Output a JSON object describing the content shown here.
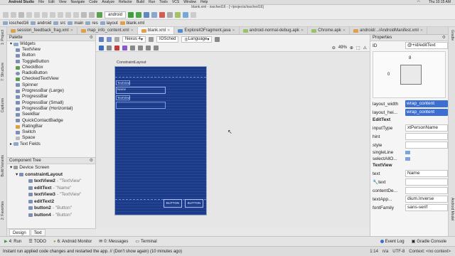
{
  "mac_menu": {
    "app": "Android Studio",
    "items": [
      "File",
      "Edit",
      "View",
      "Navigate",
      "Code",
      "Analyze",
      "Refactor",
      "Build",
      "Run",
      "Tools",
      "VCS",
      "Window",
      "Help"
    ],
    "clock": "Thu 10:15 AM"
  },
  "window_title": "blank.xml - iosched16 - [~/projects/iosched16]",
  "toolbar": {
    "run_config": "android"
  },
  "breadcrumbs": [
    "iosched16",
    "android",
    "src",
    "main",
    "res",
    "layout",
    "blank.xml"
  ],
  "tabs": [
    "session_feedback_frag.xml",
    "map_info_content.xml",
    "blank.xml",
    "ExploreIOFragment.java",
    "android-normal-debug.apk",
    "Chrome.apk",
    "android/.../AndroidManifest.xml"
  ],
  "active_tab": "blank.xml",
  "palette": {
    "title": "Palette",
    "group": "Widgets",
    "items": [
      "TextView",
      "Button",
      "ToggleButton",
      "CheckBox",
      "RadioButton",
      "CheckedTextView",
      "Spinner",
      "ProgressBar (Large)",
      "ProgressBar",
      "ProgressBar (Small)",
      "ProgressBar (Horizontal)",
      "SeekBar",
      "QuickContactBadge",
      "RatingBar",
      "Switch",
      "Space"
    ],
    "next_group": "Text Fields"
  },
  "component_tree": {
    "title": "Component Tree",
    "root": "Device Screen",
    "layout": "constraintLayout",
    "children": [
      {
        "id": "textView2",
        "desc": "- \"TextView\""
      },
      {
        "id": "editText",
        "desc": "- \"Name\""
      },
      {
        "id": "textView3",
        "desc": "- \"TextView\""
      },
      {
        "id": "editText2",
        "desc": ""
      },
      {
        "id": "button2",
        "desc": "- \"Button\""
      },
      {
        "id": "button4",
        "desc": "- \"Button\""
      }
    ]
  },
  "editor": {
    "device": "Nexus 4",
    "theme": "IOSched",
    "language": "Language",
    "zoom": "49%",
    "canvas_label": "ConstraintLayout",
    "widgets": {
      "tv1": "TextView",
      "et1": "Name",
      "tv2": "TextView",
      "btn1": "BUTTON",
      "btn2": "BUTTON"
    }
  },
  "mode_tabs": [
    "Design",
    "Text"
  ],
  "properties": {
    "title": "Properties",
    "id_label": "ID",
    "id_value": "@+id/editText",
    "constraint_top": "8",
    "constraint_left": "0",
    "layout_width_label": "layout_width",
    "layout_width_value": "wrap_content",
    "layout_height_label": "layout_hei...",
    "layout_height_value": "wrap_content",
    "section_edittext": "EditText",
    "input_type_label": "inputType",
    "input_type_value": "xtPersonName",
    "hint_label": "hint",
    "style_label": "style",
    "single_line_label": "singleLine",
    "select_all_label": "selectAllO...",
    "section_textview": "TextView",
    "text_label": "text",
    "text_value": "Name",
    "text2_label": "text",
    "content_desc_label": "contentDe...",
    "text_appearance_label": "textApp...",
    "text_appearance_value": "dium.Inverse",
    "font_family_label": "fontFamily",
    "font_family_value": "sans-serif"
  },
  "bottom_tools": [
    "4: Run",
    "TODO",
    "6: Android Monitor",
    "0: Messages",
    "Terminal"
  ],
  "bottom_right": [
    "Event Log",
    "Gradle Console"
  ],
  "status_message": "Instant run applied code changes and restarted the app. // (Don't show again) (10 minutes ago)",
  "status_right": [
    "1:14",
    "n/a",
    "UTF-8",
    "Context: <no context>"
  ],
  "side_tabs_left": [
    "1: Project",
    "7: Structure",
    "Captures",
    "Build Variants",
    "2: Favorites"
  ],
  "side_tabs_right": [
    "Gradle",
    "Android Model"
  ],
  "colors": {
    "canvas_blue": "#1b3a8a",
    "accent": "#3d6fd3"
  }
}
